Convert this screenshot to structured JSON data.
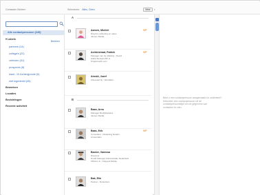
{
  "header": {
    "app_title": "Contacten Beheer",
    "selection_label": "Selecteren:",
    "selection_link": "Alles, Geen",
    "more_button": "Meer"
  },
  "sidebar": {
    "search_placeholder": "",
    "selected_item": "Alle contactpersonen (245)",
    "labels_heading": "Labels",
    "manage_link": "Beheren",
    "labels": [
      "partners (14)",
      "collega's (22)",
      "vrienden (31)",
      "prospects (8)",
      "klant - ID Achtergronde (6)",
      "niet ingedeeld (45)"
    ],
    "sections": [
      "Bewerken",
      "Locaties",
      "Bezichtingen",
      "Recente activiteit"
    ]
  },
  "list": {
    "letters": [
      "A",
      "B"
    ],
    "rows": [
      {
        "name": "Aarsen, Michiel",
        "line1": "Directie marketing en sales",
        "line2": "Jansen Media",
        "line3": "",
        "star": "VIP",
        "photo": "person-pink"
      },
      {
        "name": "Achterstraat, Patrick",
        "line1": "Manager van de afdeling - Noord",
        "line2": "Alpha Netwerk BV &",
        "line3": "Kinglematch.com",
        "star": "VIP",
        "photo": "person-dark"
      },
      {
        "name": "Arnold, Jozef",
        "line1": "Advocaat bij - Westfalen",
        "line2": "",
        "line3": "",
        "star": "",
        "photo": "person-yellow"
      },
      {
        "name": "Baan, Arno",
        "line1": "Manager Bedrijfsadvies",
        "line2": "Jansen Media",
        "line3": "",
        "star": "",
        "photo": "person-face"
      },
      {
        "name": "Baas, Erik",
        "line1": "Consultant - Marketing Notaris",
        "line2": "Amsterdam",
        "line3": "",
        "star": "VIP",
        "photo": "person-face"
      },
      {
        "name": "Backer, Vanessa",
        "line1": "Directeur",
        "line2": "Hoofd Manager Administratie Nederland",
        "line3": "Officie's & - Holgood Mobile",
        "star": "",
        "photo": "person-hat"
      },
      {
        "name": "Bak, Elin",
        "line1": "Partner - Rotterdam",
        "line2": "",
        "line3": "",
        "star": "",
        "photo": "person-face"
      }
    ]
  },
  "right_panel": {
    "hint_lines": [
      "Bent u een contactpersoon aangemaakt en onderkent?",
      "Selecteer een contactpersoon uit de",
      "contactpersoonslijst om de gegevens van",
      "contacten te zien."
    ]
  },
  "colors": {
    "accent": "#3b6fb6",
    "selected_bg": "#dde7f3",
    "star": "#e8903a"
  }
}
